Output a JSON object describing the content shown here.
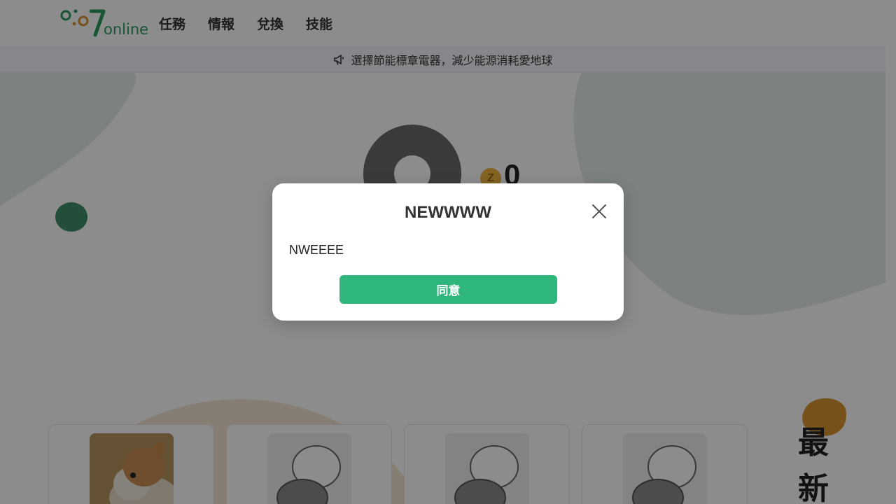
{
  "header": {
    "logo_text": "online",
    "logo_digits": "007",
    "nav": [
      "任務",
      "情報",
      "兌換",
      "技能"
    ]
  },
  "announcement": {
    "icon": "megaphone-icon",
    "text": "選擇節能標章電器，減少能源消耗愛地球"
  },
  "profile": {
    "coin_symbol": "Z",
    "points": "0"
  },
  "latest": {
    "label": "最新"
  },
  "modal": {
    "title": "NEWWWW",
    "body": "NWEEEE",
    "confirm_label": "同意",
    "close_icon": "close-icon"
  },
  "colors": {
    "brand_green": "#2eb67d",
    "logo_green": "#2f9a5f",
    "accent_orange": "#d89430",
    "coin_gold": "#f0b640"
  }
}
